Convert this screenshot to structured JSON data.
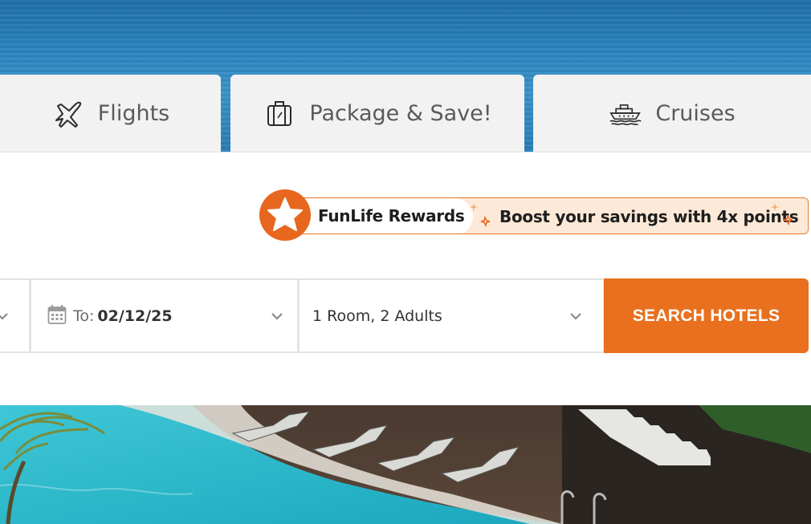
{
  "tabs": [
    {
      "label": "Flights",
      "icon": "airplane-icon"
    },
    {
      "label": "Package & Save!",
      "icon": "suitcase-icon"
    },
    {
      "label": "Cruises",
      "icon": "cruise-ship-icon"
    }
  ],
  "rewards": {
    "title": "FunLife Rewards",
    "message": "Boost your savings with 4x points",
    "icon": "star-icon"
  },
  "search": {
    "to_label": "To:",
    "to_value": "02/12/25",
    "rooms_value": "1 Room, 2 Adults",
    "button_label": "SEARCH HOTELS"
  },
  "colors": {
    "accent": "#e8701e",
    "tab_bg": "#f2f2f2",
    "banner_bg": "#fde9d8"
  }
}
